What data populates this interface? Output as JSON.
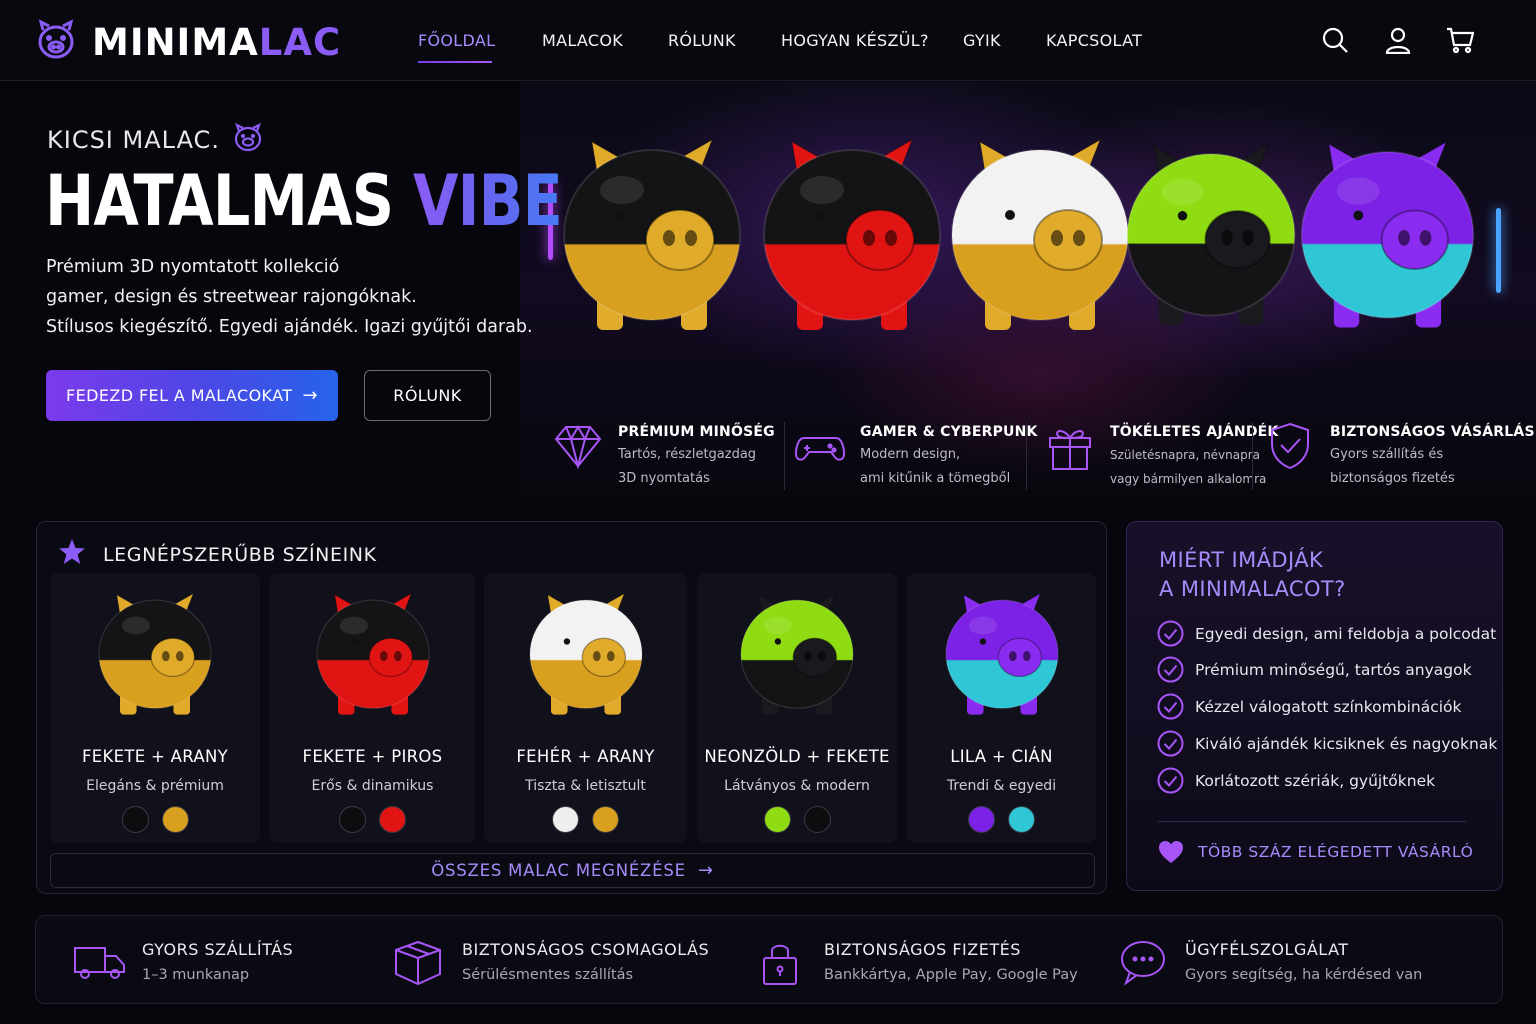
{
  "brand": {
    "name_part1": "MINIMA",
    "name_part2": "LAC",
    "logo_icon": "pig-icon"
  },
  "nav": {
    "items": [
      {
        "label": "FŐOLDAL",
        "active": true
      },
      {
        "label": "MALACOK"
      },
      {
        "label": "RÓLUNK"
      },
      {
        "label": "HOGYAN KÉSZÜL?"
      },
      {
        "label": "GYIK"
      },
      {
        "label": "KAPCSOLAT"
      }
    ],
    "icons": [
      "search-icon",
      "user-icon",
      "cart-icon"
    ]
  },
  "hero": {
    "kicker": "KICSI MALAC.",
    "headline_white": "HATALMAS ",
    "headline_gradient": "VIBE.",
    "lead_line1": "Prémium 3D nyomtatott kollekció",
    "lead_line2": "gamer, design és streetwear rajongóknak.",
    "lead_line3": "Stílusos kiegészítő. Egyedi ajándék. Igazi gyűjtői darab.",
    "cta_primary": "FEDEZD FEL A MALACOKAT",
    "cta_secondary": "RÓLUNK"
  },
  "features": [
    {
      "icon": "diamond-icon",
      "title": "PRÉMIUM MINŐSÉG",
      "line1": "Tartós, részletgazdag",
      "line2": "3D nyomtatás"
    },
    {
      "icon": "gamepad-icon",
      "title": "GAMER & CYBERPUNK",
      "line1": "Modern design,",
      "line2": "ami kitűnik a tömegből"
    },
    {
      "icon": "gift-icon",
      "title": "TÖKÉLETES AJÁNDÉK",
      "line1": "Születésnapra, névnapra",
      "line2": "vagy bármilyen alkalomra"
    },
    {
      "icon": "shield-check-icon",
      "title": "BIZTONSÁGOS VÁSÁRLÁS",
      "line1": "Gyors szállítás és",
      "line2": "biztonságos fizetés"
    }
  ],
  "popular": {
    "title": "LEGNÉPSZERŰBB SZÍNEINK",
    "cards": [
      {
        "name": "FEKETE + ARANY",
        "desc": "Elegáns & prémium",
        "colors": [
          "#0d0d0f",
          "#d9a020"
        ]
      },
      {
        "name": "FEKETE + PIROS",
        "desc": "Erős & dinamikus",
        "colors": [
          "#0d0d0f",
          "#e11414"
        ]
      },
      {
        "name": "FEHÉR + ARANY",
        "desc": "Tiszta & letisztult",
        "colors": [
          "#eeeeee",
          "#d9a020"
        ]
      },
      {
        "name": "NEONZÖLD + FEKETE",
        "desc": "Látványos & modern",
        "colors": [
          "#8fdc12",
          "#0d0d0f"
        ]
      },
      {
        "name": "LILA + CIÁN",
        "desc": "Trendi & egyedi",
        "colors": [
          "#7c22e6",
          "#2fc6d6"
        ]
      }
    ],
    "view_all": "ÖSSZES MALAC MEGNÉZÉSE"
  },
  "why": {
    "title_line1": "MIÉRT IMÁDJÁK",
    "title_line2": "A MINIMALACOT?",
    "items": [
      "Egyedi design, ami feldobja a polcodat",
      "Prémium minőségű, tartós anyagok",
      "Kézzel válogatott színkombinációk",
      "Kiváló ajándék kicsiknek és nagyoknak",
      "Korlátozott szériák, gyűjtőknek"
    ],
    "footer": "TÖBB SZÁZ ELÉGEDETT VÁSÁRLÓ"
  },
  "bottom": [
    {
      "icon": "truck-icon",
      "title": "GYORS SZÁLLÍTÁS",
      "sub": "1–3 munkanap"
    },
    {
      "icon": "box-icon",
      "title": "BIZTONSÁGOS CSOMAGOLÁS",
      "sub": "Sérülésmentes szállítás"
    },
    {
      "icon": "lock-icon",
      "title": "BIZTONSÁGOS FIZETÉS",
      "sub": "Bankkártya, Apple Pay, Google Pay"
    },
    {
      "icon": "chat-icon",
      "title": "ÜGYFÉLSZOLGÁLAT",
      "sub": "Gyors segítség, ha kérdésed van"
    }
  ],
  "colors": {
    "accent": "#8b5cf6",
    "accent_light": "#a78bfa",
    "background": "#06060c"
  }
}
